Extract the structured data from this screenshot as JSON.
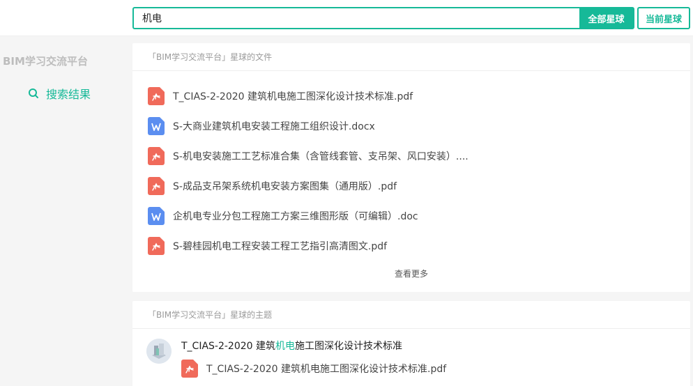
{
  "search": {
    "query": "机电",
    "all_label": "全部星球",
    "current_label": "当前星球"
  },
  "sidebar": {
    "brand": "BIM学习交流平台",
    "items": [
      {
        "label": "搜索结果",
        "icon": "search-icon"
      }
    ]
  },
  "files_section": {
    "title": "「BIM学习交流平台」星球的文件",
    "items": [
      {
        "name": "T_CIAS-2-2020 建筑机电施工图深化设计技术标准.pdf",
        "type": "pdf"
      },
      {
        "name": "S-大商业建筑机电安装工程施工组织设计.docx",
        "type": "word"
      },
      {
        "name": "S-机电安装施工工艺标准合集（含管线套管、支吊架、风口安装）....",
        "type": "pdf"
      },
      {
        "name": "S-成品支吊架系统机电安装方案图集（通用版）.pdf",
        "type": "pdf"
      },
      {
        "name": "企机电专业分包工程施工方案三维图形版（可编辑）.doc",
        "type": "word"
      },
      {
        "name": "S-碧桂园机电工程安装工程工艺指引高清图文.pdf",
        "type": "pdf"
      }
    ],
    "more_label": "查看更多"
  },
  "topics_section": {
    "title": "「BIM学习交流平台」星球的主题",
    "items": [
      {
        "title_pre": "T_CIAS-2-2020 建筑",
        "title_hl": "机电",
        "title_post": "施工图深化设计技术标准",
        "file": "T_CIAS-2-2020 建筑机电施工图深化设计技术标准.pdf"
      }
    ]
  },
  "colors": {
    "accent": "#16b998",
    "pdf": "#f06a5a",
    "word": "#5b8ef0"
  }
}
